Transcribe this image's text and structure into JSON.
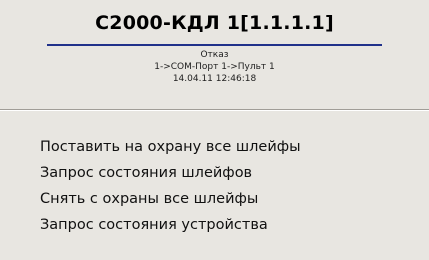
{
  "device": {
    "title": "С2000-КДЛ 1[1.1.1.1]",
    "status": "Отказ",
    "path": "1->COM-Порт 1->Пульт 1",
    "timestamp": "14.04.11 12:46:18"
  },
  "menu": {
    "items": [
      {
        "label": "Поставить на охрану все шлейфы"
      },
      {
        "label": "Запрос состояния шлейфов"
      },
      {
        "label": "Снять с охраны все шлейфы"
      },
      {
        "label": "Запрос состояния устройства"
      }
    ]
  },
  "colors": {
    "background": "#e8e6e1",
    "title_underline": "#20318a"
  }
}
